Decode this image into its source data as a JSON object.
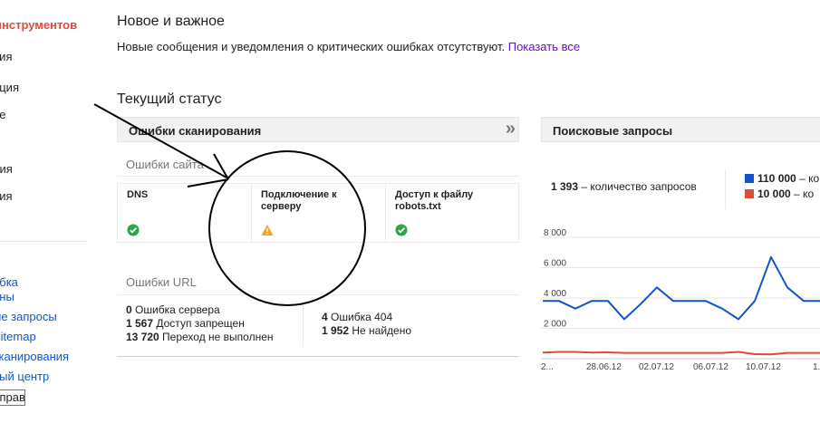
{
  "sidebar": {
    "title": "инструментов",
    "items": [
      "ния",
      "ация",
      "ие",
      "",
      "ция",
      "рия"
    ],
    "links": [
      "ибка",
      "ины",
      "ые запросы",
      "Sitemap",
      "сканирования",
      "ный центр"
    ],
    "input_value": "справ"
  },
  "news": {
    "title": "Новое и важное",
    "text": "Новые сообщения и уведомления о критических ошибках отсутствуют.",
    "link": "Показать все"
  },
  "status": {
    "title": "Текущий статус"
  },
  "crawl": {
    "title": "Ошибки сканирования",
    "chevron": "»",
    "site_errors_label": "Ошибки сайта",
    "tiles": [
      {
        "label": "DNS",
        "status": "ok"
      },
      {
        "label": "Подключение к серверу",
        "status": "warning"
      },
      {
        "label": "Доступ к файлу robots.txt",
        "status": "ok"
      }
    ],
    "url_errors_label": "Ошибки URL",
    "url_errors_left": [
      {
        "count": "0",
        "label": "Ошибка сервера"
      },
      {
        "count": "1 567",
        "label": "Доступ запрещен"
      },
      {
        "count": "13 720",
        "label": "Переход не выполнен"
      }
    ],
    "url_errors_right": [
      {
        "count": "4",
        "label": "Ошибка 404"
      },
      {
        "count": "1 952",
        "label": "Не найдено"
      }
    ]
  },
  "queries": {
    "title": "Поисковые запросы",
    "summary_count": "1 393",
    "summary_label": "– количество запросов",
    "legend": [
      {
        "value": "110 000",
        "suffix": "– ко",
        "color": "#1155cc"
      },
      {
        "value": "10 000",
        "suffix": "– ко",
        "color": "#dd4b39"
      }
    ]
  },
  "chart_data": {
    "type": "line",
    "y_ticks": [
      "8 000",
      "6 000",
      "4 000",
      "2 000"
    ],
    "y_tick_values": [
      8000,
      6000,
      4000,
      2000
    ],
    "x_ticks": [
      "2...",
      "28.06.12",
      "02.07.12",
      "06.07.12",
      "10.07.12",
      "1..."
    ],
    "ylim": [
      0,
      8000
    ],
    "grid": true,
    "series": [
      {
        "color": "#1155cc",
        "values": [
          3800,
          3800,
          3300,
          3800,
          3800,
          2600,
          3600,
          4700,
          3800,
          3800,
          3800,
          3300,
          2600,
          3800,
          6700,
          4700,
          3800,
          3800,
          3100
        ]
      },
      {
        "color": "#dd4b39",
        "values": [
          400,
          450,
          450,
          400,
          420,
          380,
          380,
          380,
          380,
          380,
          380,
          380,
          450,
          300,
          280,
          380,
          380,
          380,
          380
        ]
      }
    ]
  }
}
